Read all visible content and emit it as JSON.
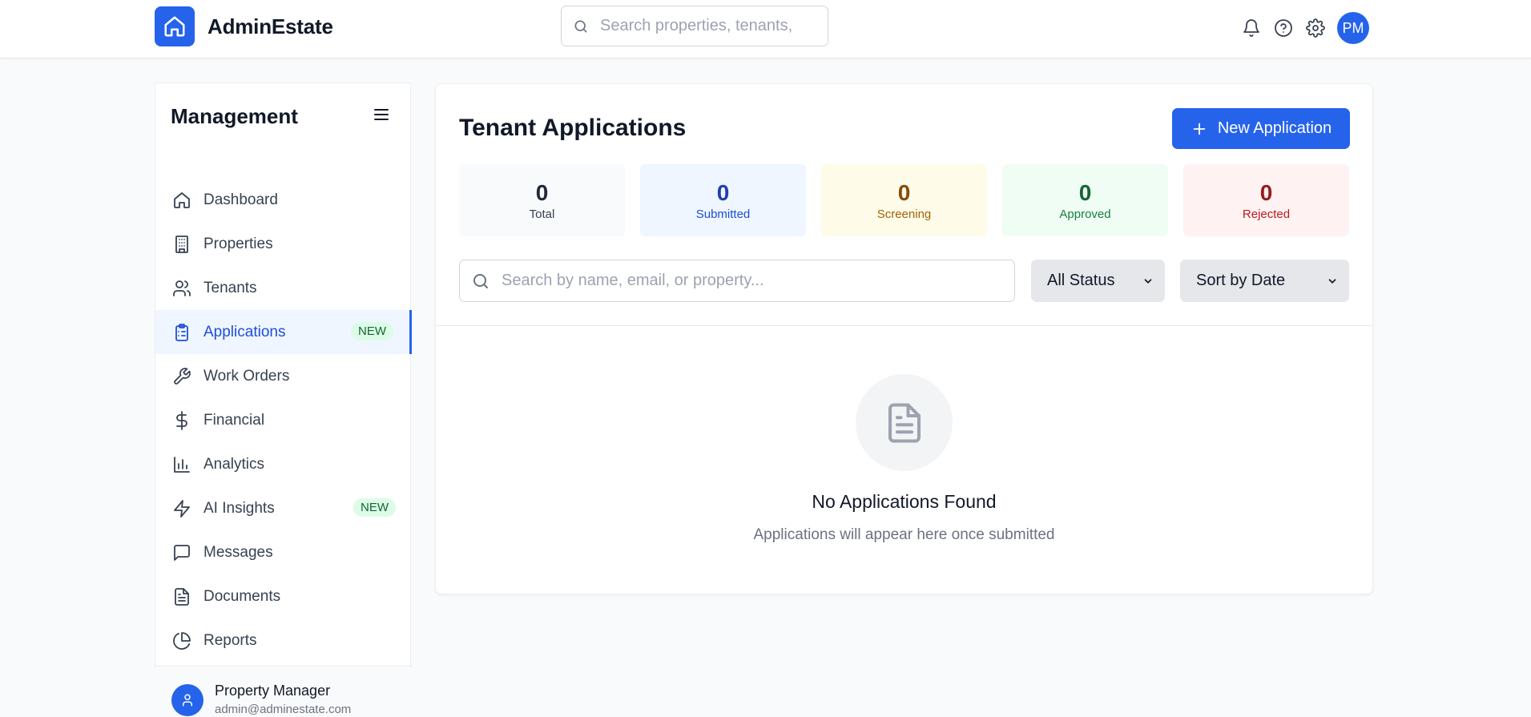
{
  "header": {
    "brand_name": "AdminEstate",
    "search_placeholder": "Search properties, tenants,",
    "avatar_initials": "PM"
  },
  "sidebar": {
    "title": "Management",
    "items": [
      {
        "label": "Dashboard",
        "icon": "home-icon"
      },
      {
        "label": "Properties",
        "icon": "building-icon"
      },
      {
        "label": "Tenants",
        "icon": "users-icon"
      },
      {
        "label": "Applications",
        "icon": "clipboard-icon",
        "badge": "NEW",
        "active": true
      },
      {
        "label": "Work Orders",
        "icon": "wrench-icon"
      },
      {
        "label": "Financial",
        "icon": "dollar-icon"
      },
      {
        "label": "Analytics",
        "icon": "bar-chart-icon"
      },
      {
        "label": "AI Insights",
        "icon": "lightning-icon",
        "badge": "NEW"
      },
      {
        "label": "Messages",
        "icon": "message-icon"
      },
      {
        "label": "Documents",
        "icon": "document-icon"
      },
      {
        "label": "Reports",
        "icon": "pie-chart-icon"
      }
    ],
    "profile": {
      "name": "Property Manager",
      "email": "admin@adminestate.com"
    }
  },
  "main": {
    "title": "Tenant Applications",
    "new_button_label": "New Application",
    "stats": [
      {
        "value": "0",
        "label": "Total"
      },
      {
        "value": "0",
        "label": "Submitted"
      },
      {
        "value": "0",
        "label": "Screening"
      },
      {
        "value": "0",
        "label": "Approved"
      },
      {
        "value": "0",
        "label": "Rejected"
      }
    ],
    "search_placeholder": "Search by name, email, or property...",
    "status_filter": "All Status",
    "sort_filter": "Sort by Date",
    "empty_title": "No Applications Found",
    "empty_subtitle": "Applications will appear here once submitted"
  },
  "colors": {
    "accent": "#2563eb",
    "badge_bg": "#dcfce7",
    "badge_text": "#166534"
  }
}
